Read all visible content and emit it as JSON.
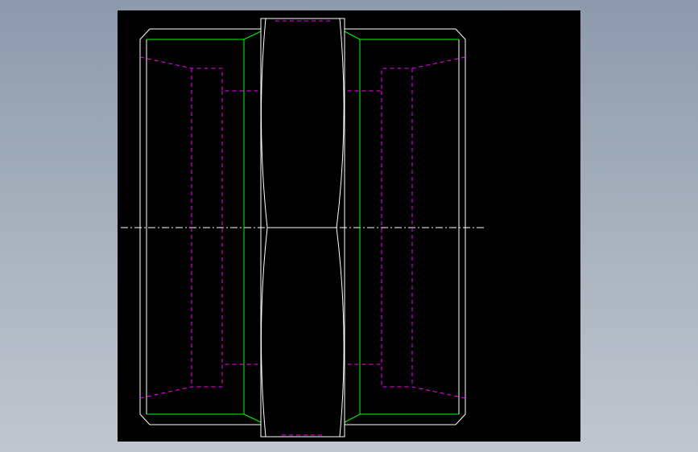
{
  "viewport": {
    "background": "#000000",
    "colors": {
      "outline": "#ffffff",
      "chamfer": "#00ff00",
      "hidden": "#ff00ff",
      "centerline": "#ffffff"
    }
  }
}
